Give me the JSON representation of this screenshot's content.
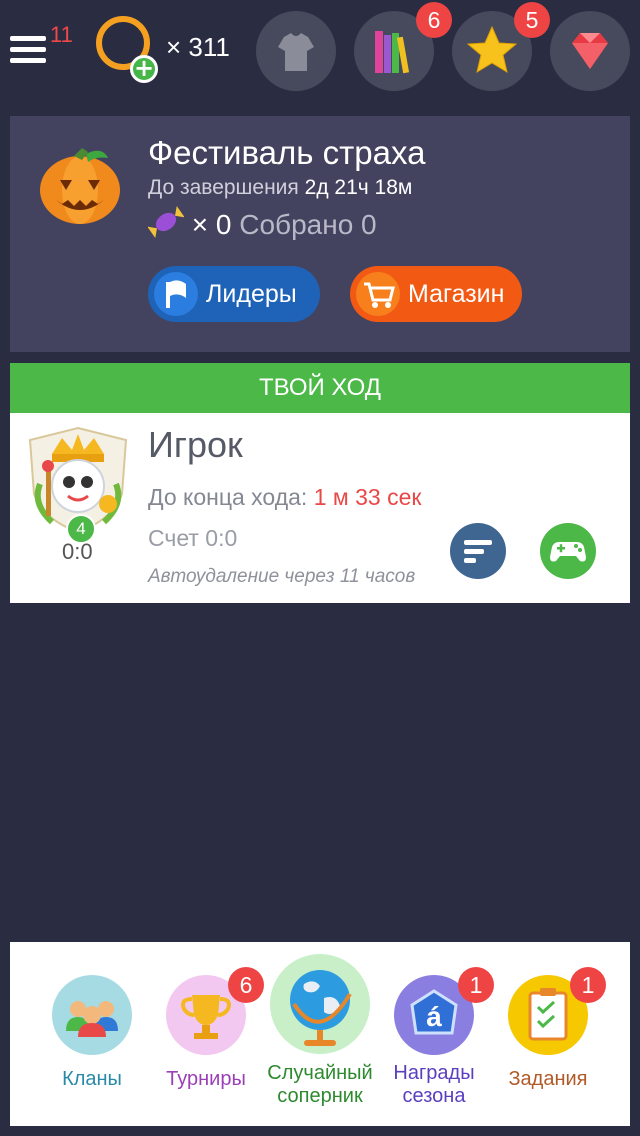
{
  "topbar": {
    "menu_count": "11",
    "coins": "× 311",
    "badges": {
      "books": "6",
      "favorites": "5"
    },
    "icons": [
      "menu-icon",
      "coin-add-icon",
      "shirt-icon",
      "books-icon",
      "star-icon",
      "gem-icon"
    ]
  },
  "event": {
    "title": "Фестиваль страха",
    "deadline_label": "До завершения",
    "deadline_value": "2д 21ч 18м",
    "candy_count": "× 0",
    "collected": "Собрано 0",
    "leaders_label": "Лидеры",
    "shop_label": "Магазин"
  },
  "turn": {
    "banner": "ТВОЙ ХОД",
    "player_name": "Игрок",
    "timer_label": "До конца хода:",
    "timer_value": "1 м 33 сек",
    "score": "Счет 0:0",
    "autodelete": "Автоудаление через 11 часов",
    "avatar_level": "4",
    "avatar_score": "0:0"
  },
  "bottom_nav": {
    "clans": "Кланы",
    "tournaments": "Турниры",
    "tournaments_badge": "6",
    "random_line1": "Случайный",
    "random_line2": "соперник",
    "season_line1": "Награды",
    "season_line2": "сезона",
    "season_badge": "1",
    "tasks": "Задания",
    "tasks_badge": "1"
  },
  "colors": {
    "background": "#2a2d42",
    "event_card": "#44435f",
    "turn_green": "#4cb848",
    "timer_red": "#e84848",
    "badge_red": "#ef4444",
    "leaders_blue": "#1e63b8",
    "shop_orange": "#f25a14"
  }
}
